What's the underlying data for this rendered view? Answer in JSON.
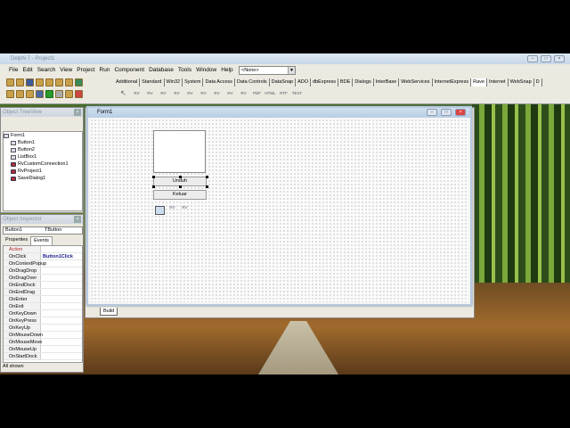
{
  "ide": {
    "title": "Delphi 7 - Project1",
    "menu": [
      "File",
      "Edit",
      "Search",
      "View",
      "Project",
      "Run",
      "Component",
      "Database",
      "Tools",
      "Window",
      "Help"
    ],
    "config_combo": "<None>",
    "palette_tabs": [
      "Additional",
      "Standard",
      "Win32",
      "System",
      "Data Access",
      "Data Controls",
      "DataSnap",
      "ADO",
      "dbExpress",
      "BDE",
      "Dialogs",
      "InterBase",
      "WebServices",
      "InternetExpress",
      "Rave",
      "Internet",
      "WebSnap",
      "D"
    ],
    "active_palette_tab": "Rave",
    "palette_icons": [
      "RV",
      "RV",
      "RV",
      "RV",
      "RV",
      "RV",
      "RV",
      "RV",
      "RV",
      "PDF",
      "HTML",
      "RTF",
      "TEXT"
    ]
  },
  "tree": {
    "title": "Object TreeView",
    "items": [
      "Form1",
      "Button1",
      "Button2",
      "ListBox1",
      "RvCustomConnection1",
      "RvProject1",
      "SaveDialog1"
    ]
  },
  "inspector": {
    "title": "Object Inspector",
    "object": "Button1",
    "type": "TButton",
    "tabs": [
      "Properties",
      "Events"
    ],
    "rows": [
      [
        "Action",
        ""
      ],
      [
        "OnClick",
        "Button1Click"
      ],
      [
        "OnContextPopup",
        ""
      ],
      [
        "OnDragDrop",
        ""
      ],
      [
        "OnDragOver",
        ""
      ],
      [
        "OnEndDock",
        ""
      ],
      [
        "OnEndDrag",
        ""
      ],
      [
        "OnEnter",
        ""
      ],
      [
        "OnExit",
        ""
      ],
      [
        "OnKeyDown",
        ""
      ],
      [
        "OnKeyPress",
        ""
      ],
      [
        "OnKeyUp",
        ""
      ],
      [
        "OnMouseDown",
        ""
      ],
      [
        "OnMouseMove",
        ""
      ],
      [
        "OnMouseUp",
        ""
      ],
      [
        "OnStartDock",
        ""
      ]
    ],
    "status": "All shown"
  },
  "form": {
    "title": "Form1",
    "button1": "Unduh",
    "button2": "Keluar",
    "nv_icons": [
      "RV",
      "RV"
    ]
  },
  "editor": {
    "tab": "Build"
  }
}
